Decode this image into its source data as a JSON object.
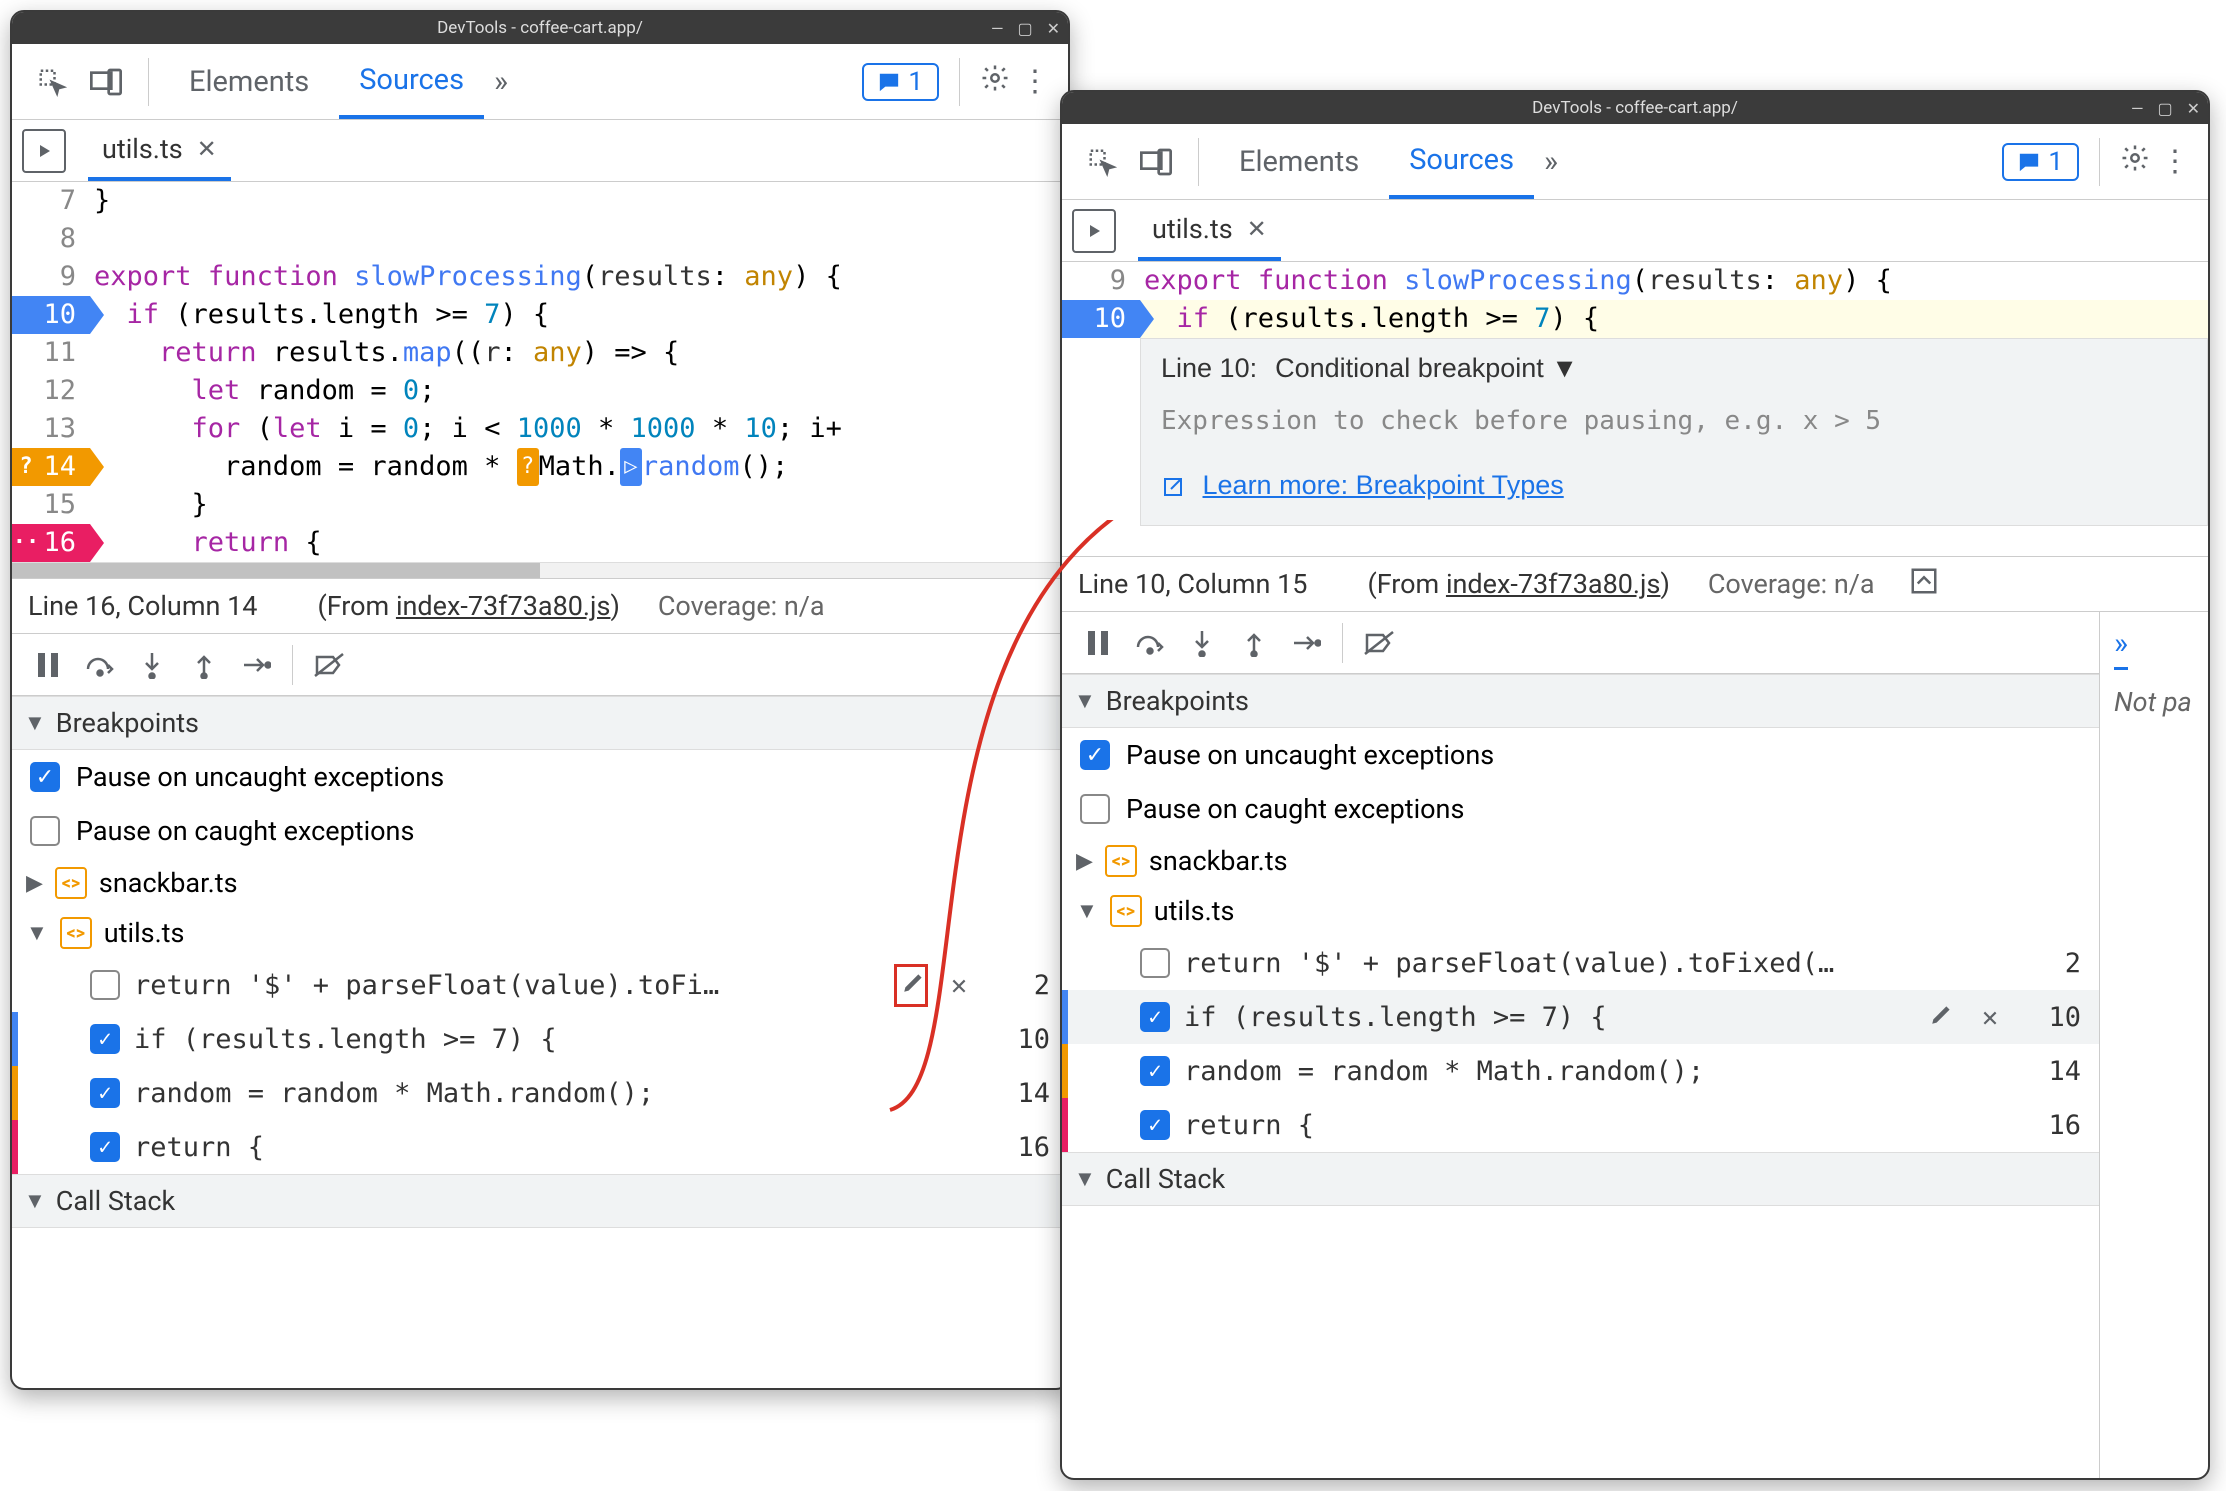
{
  "window": {
    "title": "DevTools - coffee-cart.app/"
  },
  "toolbar": {
    "tabs": {
      "elements": "Elements",
      "sources": "Sources"
    },
    "messages_count": "1"
  },
  "filetab": {
    "name": "utils.ts"
  },
  "code1": {
    "lines": [
      {
        "n": "7",
        "html": "}"
      },
      {
        "n": "8",
        "html": ""
      },
      {
        "n": "9",
        "html": "<span class='kw'>export</span> <span class='kw'>function</span> <span class='fn'>slowProcessing</span>(<span class='op'>results</span>: <span class='ty'>any</span>) {"
      },
      {
        "n": "10",
        "html": "  <span class='kw'>if</span> (results.length &gt;= <span class='num'>7</span>) {",
        "bp": "blue"
      },
      {
        "n": "11",
        "html": "    <span class='kw'>return</span> results.<span class='fn'>map</span>((<span class='op'>r</span>: <span class='ty'>any</span>) =&gt; {"
      },
      {
        "n": "12",
        "html": "      <span class='kw'>let</span> random = <span class='num'>0</span>;"
      },
      {
        "n": "13",
        "html": "      <span class='kw'>for</span> (<span class='kw'>let</span> i = <span class='num'>0</span>; i &lt; <span class='num'>1000</span> * <span class='num'>1000</span> * <span class='num'>10</span>; i+"
      },
      {
        "n": "14",
        "html": "        random = random * <span class='inline-badge'>?</span>Math.<span class='inline-badge blue'>▷</span><span class='fn'>random</span>();",
        "bp": "orange",
        "q": true
      },
      {
        "n": "15",
        "html": "      }"
      },
      {
        "n": "16",
        "html": "      <span class='kw'>return</span> {",
        "bp": "pink",
        "dots": true
      }
    ]
  },
  "code2": {
    "lines": [
      {
        "n": "9",
        "html": "<span class='kw'>export</span> <span class='kw'>function</span> <span class='fn'>slowProcessing</span>(<span class='op'>results</span>: <span class='ty'>any</span>) {"
      },
      {
        "n": "10",
        "html": "  <span class='kw'>if</span> (results.length &gt;= <span class='num'>7</span>) {",
        "bp": "blue",
        "hl": true
      }
    ]
  },
  "bp_editor": {
    "line_label": "Line 10:",
    "type": "Conditional breakpoint",
    "placeholder": "Expression to check before pausing, e.g. x > 5",
    "learn_text": "Learn more: Breakpoint Types"
  },
  "status1": {
    "pos": "Line 16, Column 14",
    "from_prefix": "(From ",
    "from_link": "index-73f73a80.js",
    "from_suffix": ")",
    "coverage": "Coverage: n/a"
  },
  "status2": {
    "pos": "Line 10, Column 15",
    "from_prefix": "(From ",
    "from_link": "index-73f73a80.js",
    "from_suffix": ")",
    "coverage": "Coverage: n/a"
  },
  "sections": {
    "breakpoints": "Breakpoints",
    "callstack": "Call Stack",
    "pause_uncaught": "Pause on uncaught exceptions",
    "pause_caught": "Pause on caught exceptions",
    "snackbar": "snackbar.ts",
    "utils": "utils.ts"
  },
  "bps1": [
    {
      "on": false,
      "ind": "",
      "text": "return '$' + parseFloat(value).toFi…",
      "ln": "2",
      "edit": true,
      "del": true
    },
    {
      "on": true,
      "ind": "blue",
      "text": "if (results.length >= 7) {",
      "ln": "10"
    },
    {
      "on": true,
      "ind": "orange",
      "text": "random = random * Math.random();",
      "ln": "14"
    },
    {
      "on": true,
      "ind": "pink",
      "text": "return {",
      "ln": "16"
    }
  ],
  "bps2": [
    {
      "on": false,
      "ind": "",
      "text": "return '$' + parseFloat(value).toFixed(…",
      "ln": "2"
    },
    {
      "on": true,
      "ind": "blue",
      "text": "if (results.length >= 7) {",
      "ln": "10",
      "edit": true,
      "del": true,
      "hover": true
    },
    {
      "on": true,
      "ind": "orange",
      "text": "random = random * Math.random();",
      "ln": "14"
    },
    {
      "on": true,
      "ind": "pink",
      "text": "return {",
      "ln": "16"
    }
  ],
  "rightpane": {
    "text": "Not pa"
  }
}
